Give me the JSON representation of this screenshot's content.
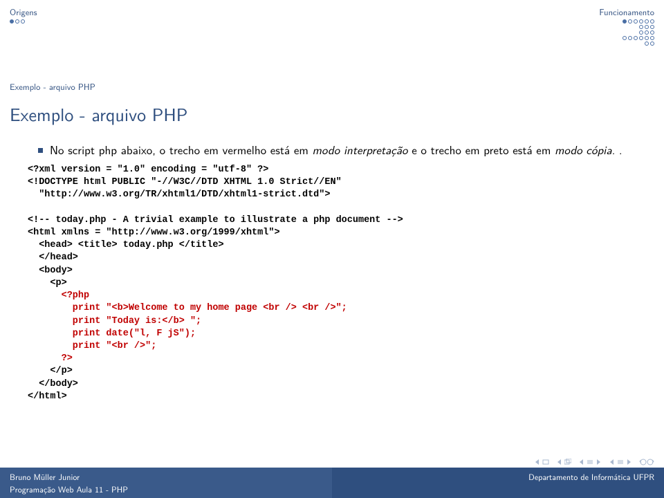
{
  "header": {
    "left_section": "Origens",
    "right_section": "Funcionamento",
    "left_dots": [
      [
        1,
        0,
        0
      ]
    ],
    "right_dots": [
      [
        1,
        0,
        0,
        0,
        0,
        0
      ],
      [
        0,
        0,
        0
      ],
      [
        0,
        0,
        0
      ],
      [
        0,
        0,
        0,
        0,
        0,
        0
      ],
      [
        0,
        0
      ]
    ]
  },
  "subsection": "Exemplo - arquivo PHP",
  "frametitle": "Exemplo - arquivo PHP",
  "bullet": {
    "t1": "No script php abaixo, o trecho em vermelho está em ",
    "i1": "modo interpretação",
    "t2": " e o trecho em preto está em ",
    "i2": "modo cópia.",
    "t3": " ."
  },
  "code": {
    "l1": "<?xml version = \"1.0\" encoding = \"utf-8\" ?>",
    "l2": "<!DOCTYPE html PUBLIC \"-//W3C//DTD XHTML 1.0 Strict//EN\"",
    "l3": "  \"http://www.w3.org/TR/xhtml1/DTD/xhtml1-strict.dtd\">",
    "l4": "",
    "l5": "<!-- today.php - A trivial example to illustrate a php document -->",
    "l6": "<html xmlns = \"http://www.w3.org/1999/xhtml\">",
    "l7": "  <head> <title> today.php </title>",
    "l8": "  </head>",
    "l9": "  <body>",
    "l10": "    <p>",
    "l11": "      <?php",
    "l12": "        print \"<b>Welcome to my home page <br /> <br />\";",
    "l13": "        print \"Today is:</b> \";",
    "l14": "        print date(\"l, F jS\");",
    "l15": "        print \"<br />\";",
    "l16": "      ?>",
    "l17": "    </p>",
    "l18": "  </body>",
    "l19": "</html>"
  },
  "footer": {
    "author": "Bruno Müller Junior",
    "institute": "Departamento de Informática   UFPR",
    "talk": "Programação Web   Aula 11 - PHP"
  }
}
